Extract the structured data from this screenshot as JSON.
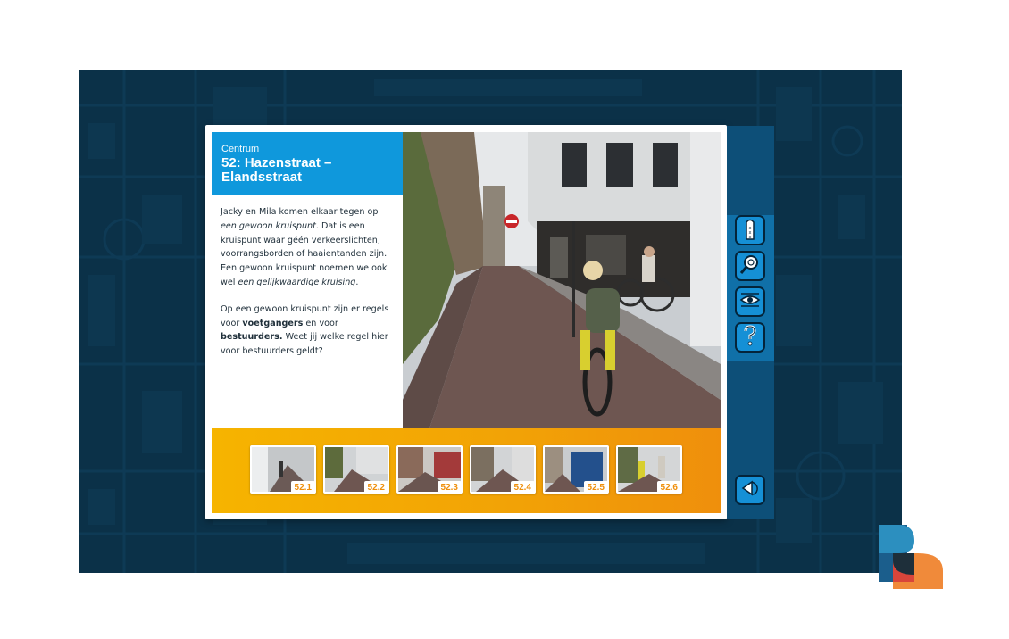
{
  "lesson": {
    "region": "Centrum",
    "title": "52: Hazenstraat – Elandsstraat",
    "intro_1": "Jacky en Mila komen elkaar tegen op ",
    "intro_em1": "een gewoon kruispunt",
    "intro_2": ". Dat is een kruispunt waar géén verkeerslichten, voorrangsborden of haaientanden zijn. Een gewoon kruispunt noemen we ook wel ",
    "intro_em2": "een gelijkwaardige kruising",
    "intro_3": ".",
    "para2_1": "Op een gewoon kruispunt zijn er regels voor ",
    "para2_b1": "voetgangers",
    "para2_2": " en voor ",
    "para2_b2": "bestuurders.",
    "para2_3": " Weet jij welke regel hier voor bestuurders geldt?"
  },
  "thumbnails": [
    {
      "label": "52.1"
    },
    {
      "label": "52.2"
    },
    {
      "label": "52.3"
    },
    {
      "label": "52.4"
    },
    {
      "label": "52.5"
    },
    {
      "label": "52.6"
    }
  ],
  "tools": [
    {
      "icon": "amsterdam-pole-icon"
    },
    {
      "icon": "magnifier-icon"
    },
    {
      "icon": "eye-icon"
    },
    {
      "icon": "question-icon"
    }
  ],
  "nav": {
    "icon": "navigate-back-icon"
  },
  "colors": {
    "background": "#0b3148",
    "header": "#0f98dc",
    "strip_start": "#f6b400",
    "strip_end": "#ef8f0c",
    "sidebar": "#0d4f78",
    "button": "#1590d6"
  }
}
